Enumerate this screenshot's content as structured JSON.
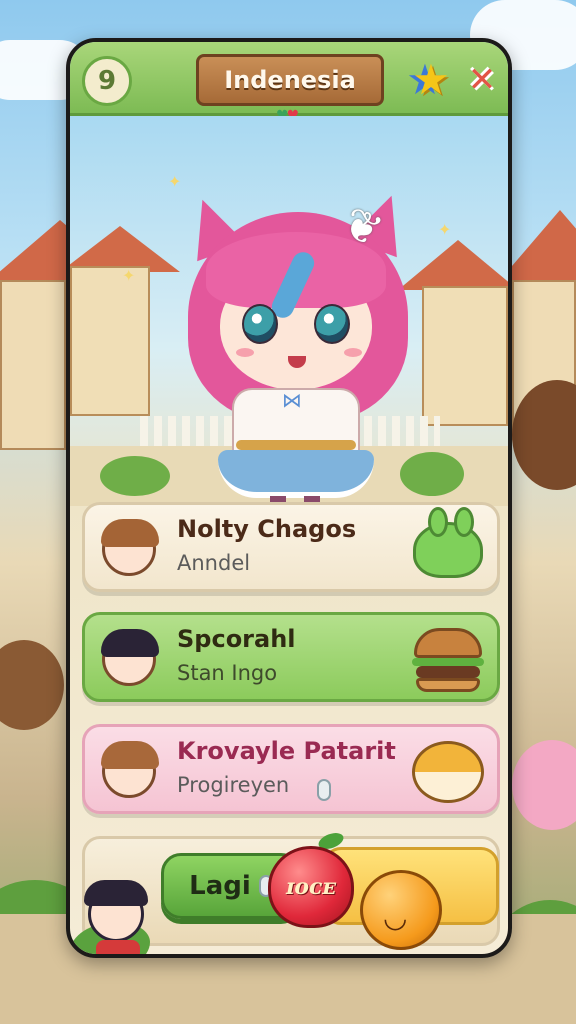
{
  "header": {
    "level_badge": "9",
    "title": "Indenesia",
    "hearts": [
      "♥",
      "♥"
    ]
  },
  "icons": {
    "star": "star-icon",
    "close": "close-icon",
    "close_glyph": "✕",
    "star_glyph": "★"
  },
  "cards": [
    {
      "name": "Nolty Chagos",
      "sub": "Anndel",
      "icon": "slime-icon"
    },
    {
      "name": "Spcorahl",
      "sub": "Stan Ingo",
      "icon": "burger-icon"
    },
    {
      "name": "Krovayle Patarit",
      "sub": "Progireyen",
      "icon": "hamster-icon"
    }
  ],
  "bottom": {
    "primary_label": "Lagi",
    "apple_text": "ɪᴏᴄᴇ"
  },
  "colors": {
    "primary_green": "#7dbb54",
    "plaque_brown": "#a66a37",
    "accent_pink": "#e3579b",
    "accent_red": "#e2384a"
  }
}
